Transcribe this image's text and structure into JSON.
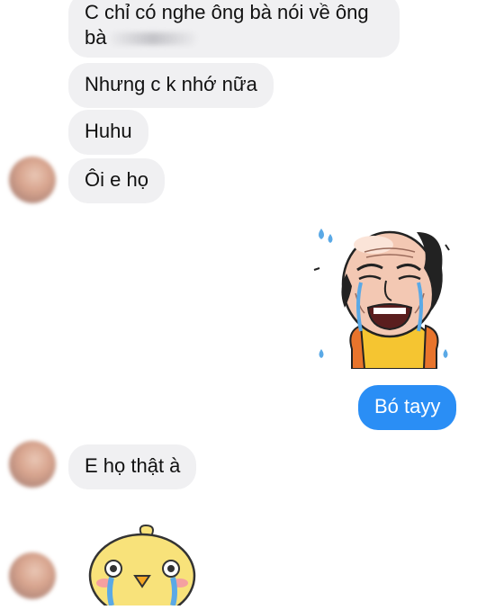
{
  "messages": {
    "m1_line1": "C chỉ có nghe ông bà nói về ông",
    "m1_line2": "bà",
    "m2": "Nhưng c k nhớ nữa",
    "m3": "Huhu",
    "m4": "Ôi e họ",
    "m5_out": "Bó tayy",
    "m6": "E họ thật à"
  },
  "stickers": {
    "crying_old_man": "crying-old-man-sticker",
    "crying_chick": "crying-chick-sticker"
  },
  "colors": {
    "incoming_bubble": "#f0f0f2",
    "outgoing_bubble": "#2a8ef5"
  }
}
